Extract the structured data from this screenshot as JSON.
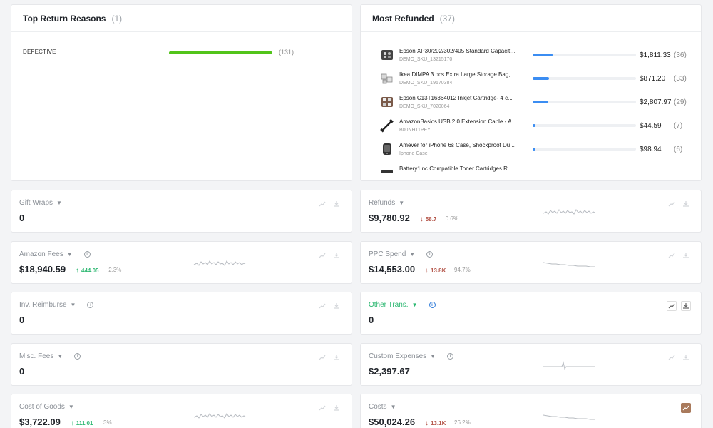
{
  "top_return_reasons": {
    "title": "Top Return Reasons",
    "count": "(1)",
    "reasons": [
      {
        "label": "DEFECTIVE",
        "fill": 1.0,
        "count": "(131)"
      }
    ]
  },
  "most_refunded": {
    "title": "Most Refunded",
    "count": "(37)",
    "items": [
      {
        "name": "Epson XP30/202/302/405 Standard Capacity...",
        "sku": "DEMO_SKU_13215170",
        "amount": "$1,811.33",
        "count": "(36)",
        "fill": 0.19,
        "icon": "printer-cartridge-icon"
      },
      {
        "name": "Ikea DIMPA 3 pcs Extra Large Storage Bag, ...",
        "sku": "DEMO_SKU_19570384",
        "amount": "$871.20",
        "count": "(33)",
        "fill": 0.16,
        "icon": "storage-bag-icon"
      },
      {
        "name": "Epson C13T16364012 Inkjet Cartridge- 4 c...",
        "sku": "DEMO_SKU_7020064",
        "amount": "$2,807.97",
        "count": "(29)",
        "fill": 0.15,
        "icon": "ink-cartridge-icon"
      },
      {
        "name": "AmazonBasics USB 2.0 Extension Cable - A...",
        "sku": "B00NH11PEY",
        "amount": "$44.59",
        "count": "(7)",
        "fill": 0.03,
        "icon": "usb-cable-icon"
      },
      {
        "name": "Amever for iPhone 6s Case, Shockproof Du...",
        "sku": "Iphone Case",
        "amount": "$98.94",
        "count": "(6)",
        "fill": 0.03,
        "icon": "phone-case-icon"
      },
      {
        "name": "Battery1inc Compatible Toner Cartridges R...",
        "sku": "",
        "amount": "",
        "count": "",
        "fill": 0.0,
        "icon": "toner-cartridge-icon"
      }
    ]
  },
  "metrics": [
    {
      "id": "gift-wraps",
      "label": "Gift Wraps",
      "value": "0",
      "change": "",
      "direction": "",
      "pct": "",
      "info": false,
      "spark": false,
      "highlight": false
    },
    {
      "id": "refunds",
      "label": "Refunds",
      "value": "$9,780.92",
      "change": "58.7",
      "direction": "down",
      "pct": "0.6%",
      "info": false,
      "spark": true,
      "highlight": false
    },
    {
      "id": "amazon-fees",
      "label": "Amazon Fees",
      "value": "$18,940.59",
      "change": "444.05",
      "direction": "up",
      "pct": "2.3%",
      "info": true,
      "spark": true,
      "highlight": false
    },
    {
      "id": "ppc-spend",
      "label": "PPC Spend",
      "value": "$14,553.00",
      "change": "13.8K",
      "direction": "down",
      "pct": "94.7%",
      "info": true,
      "spark": true,
      "highlight": false
    },
    {
      "id": "inv-reimburse",
      "label": "Inv. Reimburse",
      "value": "0",
      "change": "",
      "direction": "",
      "pct": "",
      "info": true,
      "spark": false,
      "highlight": false
    },
    {
      "id": "other-trans",
      "label": "Other Trans.",
      "value": "0",
      "change": "",
      "direction": "",
      "pct": "",
      "info": true,
      "spark": false,
      "highlight": true
    },
    {
      "id": "misc-fees",
      "label": "Misc. Fees",
      "value": "0",
      "change": "",
      "direction": "",
      "pct": "",
      "info": true,
      "spark": false,
      "highlight": false
    },
    {
      "id": "custom-expenses",
      "label": "Custom Expenses",
      "value": "$2,397.67",
      "change": "",
      "direction": "",
      "pct": "",
      "info": true,
      "spark": true,
      "highlight": false
    },
    {
      "id": "cost-of-goods",
      "label": "Cost of Goods",
      "value": "$3,722.09",
      "change": "111.01",
      "direction": "up",
      "pct": "3%",
      "info": false,
      "spark": true,
      "highlight": false
    },
    {
      "id": "costs",
      "label": "Costs",
      "value": "$50,024.26",
      "change": "13.1K",
      "direction": "down",
      "pct": "26.2%",
      "info": false,
      "spark": true,
      "highlight": false
    }
  ],
  "colors": {
    "green": "#52c41a",
    "blue_bar": "#3b8df2",
    "up": "#2eb872",
    "down": "#b5574b",
    "active_icon": "#a97a5c"
  }
}
